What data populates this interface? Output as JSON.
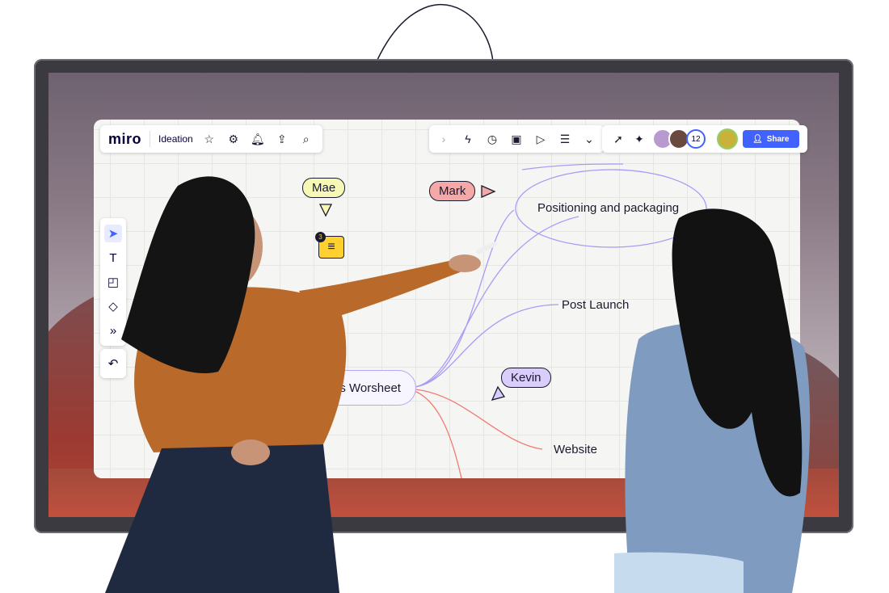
{
  "toolbar": {
    "logo": "miro",
    "board_name": "Ideation",
    "collaborator_count": "12",
    "share_label": "Share"
  },
  "cursors": {
    "mae": "Mae",
    "mark": "Mark",
    "kevin": "Kevin"
  },
  "comment": {
    "count": "3"
  },
  "mindmap": {
    "root": "Tactics Worsheet",
    "nodes": [
      "Positioning and packaging",
      "Post Launch",
      "Website"
    ]
  },
  "colors": {
    "brand": "#4262ff",
    "mae": "#f6f8b5",
    "mark": "#f4a8a8",
    "kevin": "#d9cdfc",
    "comment": "#ffd02f",
    "branch_purple": "#a99bf5",
    "branch_red": "#f17b72"
  },
  "icons": {
    "toolbar": [
      "star-icon",
      "settings-icon",
      "bell-icon",
      "upload-icon",
      "search-icon"
    ],
    "apps": [
      "chevron-right-icon",
      "lightning-icon",
      "timer-icon",
      "card-icon",
      "presentation-icon",
      "notes-icon",
      "chevrons-down-icon"
    ],
    "right": [
      "select-cursor-icon",
      "celebrate-icon",
      "user-icon"
    ],
    "side": [
      "pointer-icon",
      "text-icon",
      "sticky-note-icon",
      "shapes-icon",
      "more-icon",
      "undo-icon"
    ]
  }
}
